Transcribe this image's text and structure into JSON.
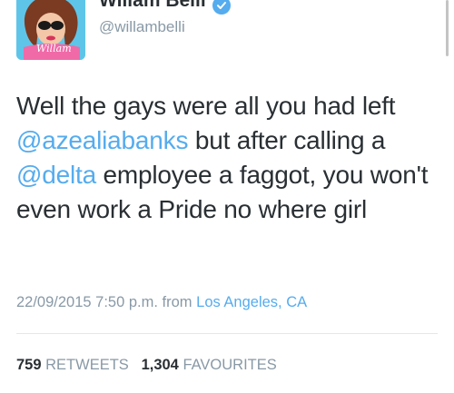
{
  "header": {
    "name": "Willam Belli",
    "handle": "@willambelli",
    "avatar_bg": "#5fc5e8",
    "verified_color": "#55acee",
    "avatar_text": "Willam"
  },
  "tweet": {
    "part1": "Well the gays were all you had left ",
    "mention1": "@azealiabanks",
    "part2": " but after calling a ",
    "mention2": "@delta",
    "part3": " employee a faggot, you won't even work a Pride no where girl"
  },
  "meta": {
    "timestamp": "22/09/2015 7:50 p.m.",
    "from_label": "from",
    "location": "Los Angeles, CA"
  },
  "stats": {
    "retweets_count": "759",
    "retweets_label": "RETWEETS",
    "favourites_count": "1,304",
    "favourites_label": "FAVOURITES"
  },
  "colors": {
    "link": "#55acee",
    "muted": "#8899a6",
    "text": "#292f33"
  }
}
